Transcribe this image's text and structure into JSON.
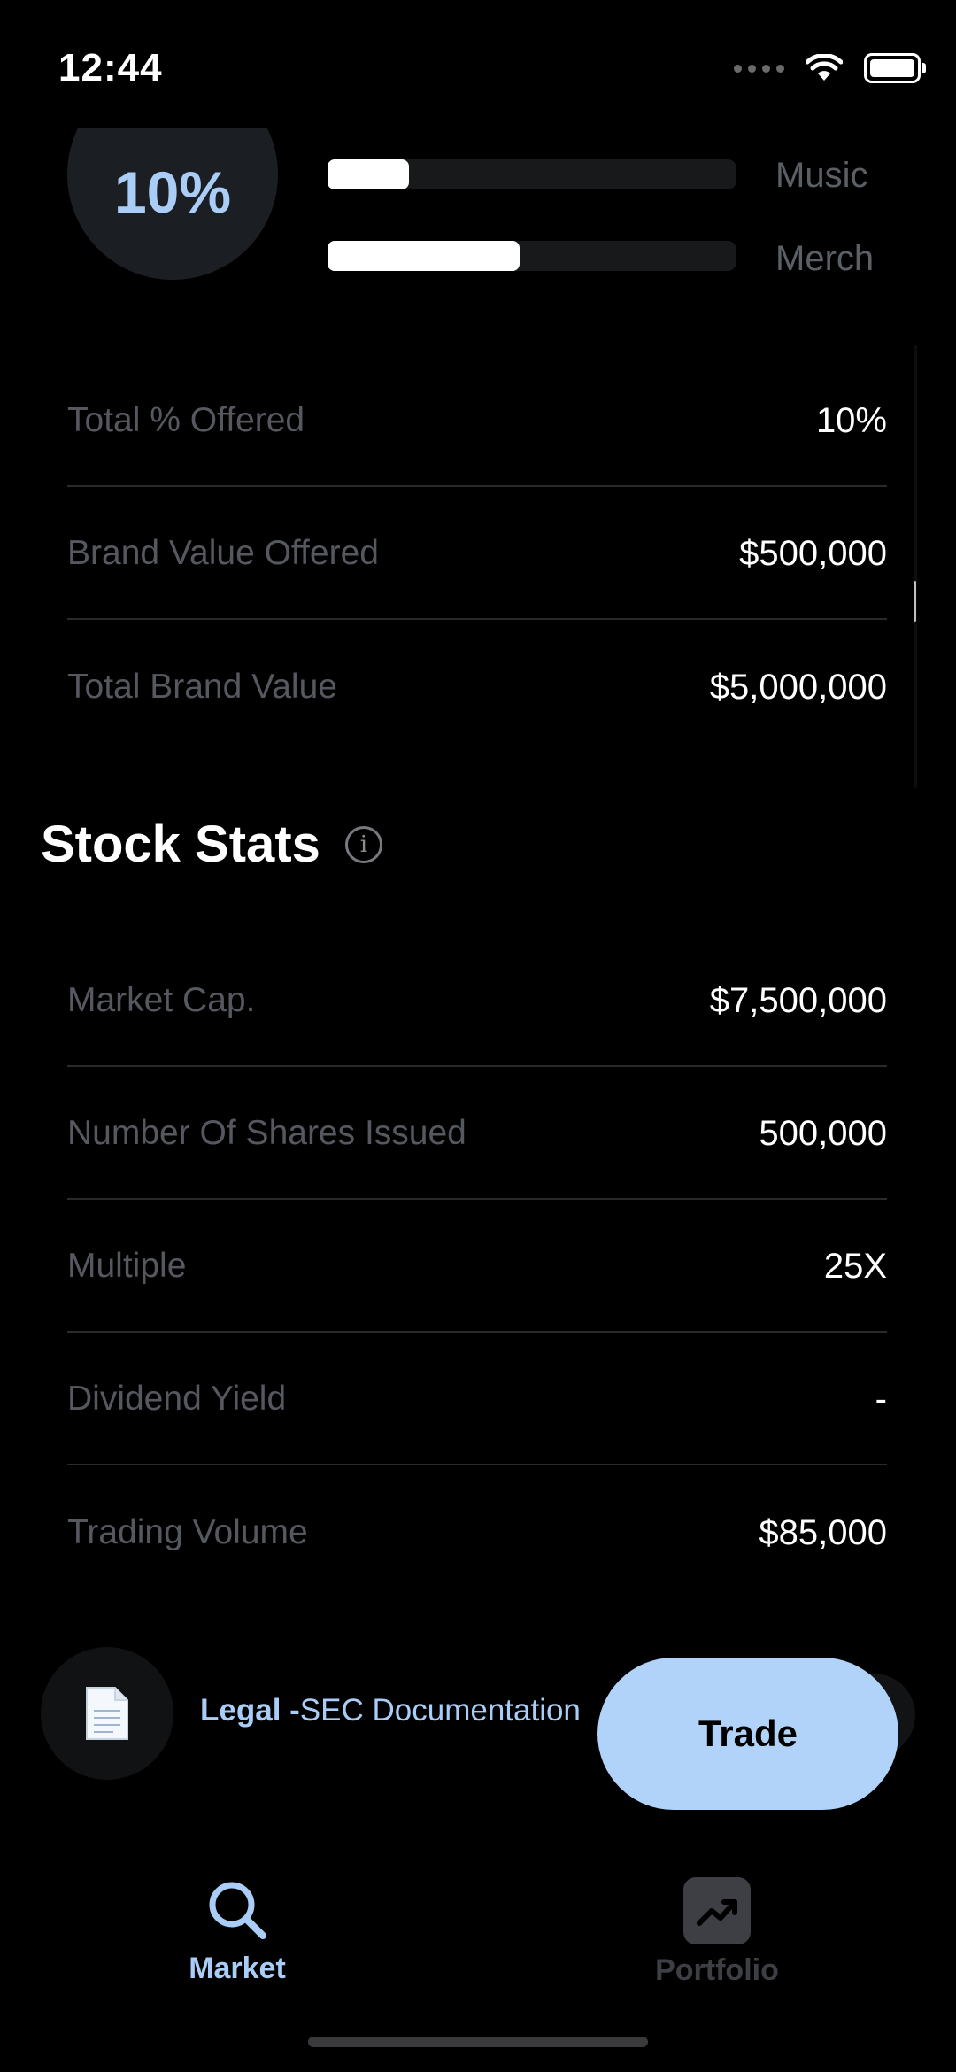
{
  "status_bar": {
    "time": "12:44"
  },
  "allocation": {
    "percent": "10%",
    "bars": [
      {
        "label": "Music",
        "fill": 0.2
      },
      {
        "label": "Merch",
        "fill": 0.47
      }
    ]
  },
  "offering": [
    {
      "label": "Total % Offered",
      "value": "10%"
    },
    {
      "label": "Brand Value Offered",
      "value": "$500,000"
    },
    {
      "label": "Total Brand Value",
      "value": "$5,000,000"
    }
  ],
  "stock_stats": {
    "title": "Stock Stats",
    "rows": [
      {
        "label": "Market Cap.",
        "value": "$7,500,000"
      },
      {
        "label": "Number Of Shares Issued",
        "value": "500,000"
      },
      {
        "label": "Multiple",
        "value": "25X"
      },
      {
        "label": "Dividend Yield",
        "value": "-"
      },
      {
        "label": "Trading Volume",
        "value": "$85,000"
      }
    ]
  },
  "legal": {
    "bold": "Legal -",
    "text": "SEC Documentation",
    "icon": "document-icon"
  },
  "trade_button": "Trade",
  "nav": {
    "market": {
      "label": "Market",
      "icon": "search-icon"
    },
    "portfolio": {
      "label": "Portfolio",
      "icon": "trending-up-icon"
    }
  },
  "colors": {
    "accent": "#b1d2f9",
    "label_gray": "#55585e",
    "background": "#000000"
  }
}
